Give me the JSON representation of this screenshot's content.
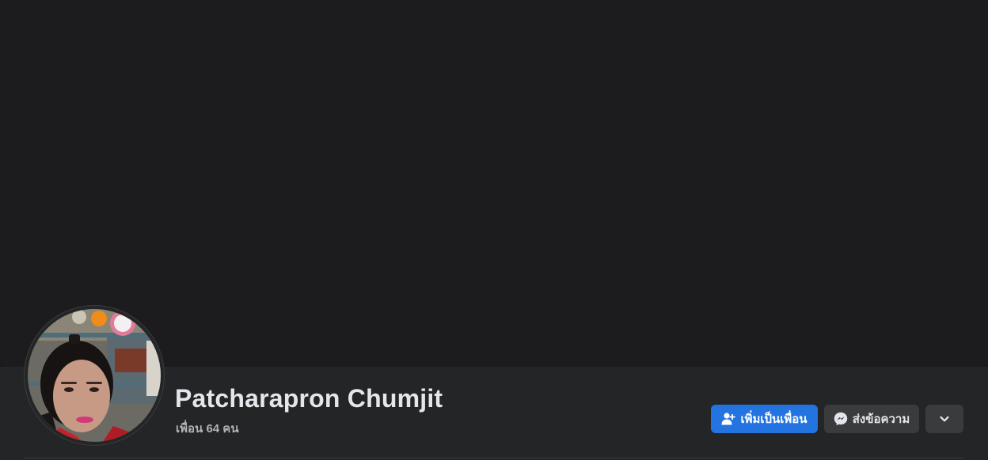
{
  "profile": {
    "name": "Patcharapron Chumjit",
    "friends_count_label": "เพื่อน 64 คน"
  },
  "actions": {
    "add_friend_label": "เพิ่มเป็นเพื่อน",
    "message_label": "ส่งข้อความ",
    "more_icon": "chevron-down-icon"
  },
  "colors": {
    "primary": "#2374e1",
    "secondary": "#3a3b3c",
    "background": "#18191a",
    "surface": "#242526",
    "text": "#e4e6eb",
    "text_secondary": "#b0b3b8"
  }
}
